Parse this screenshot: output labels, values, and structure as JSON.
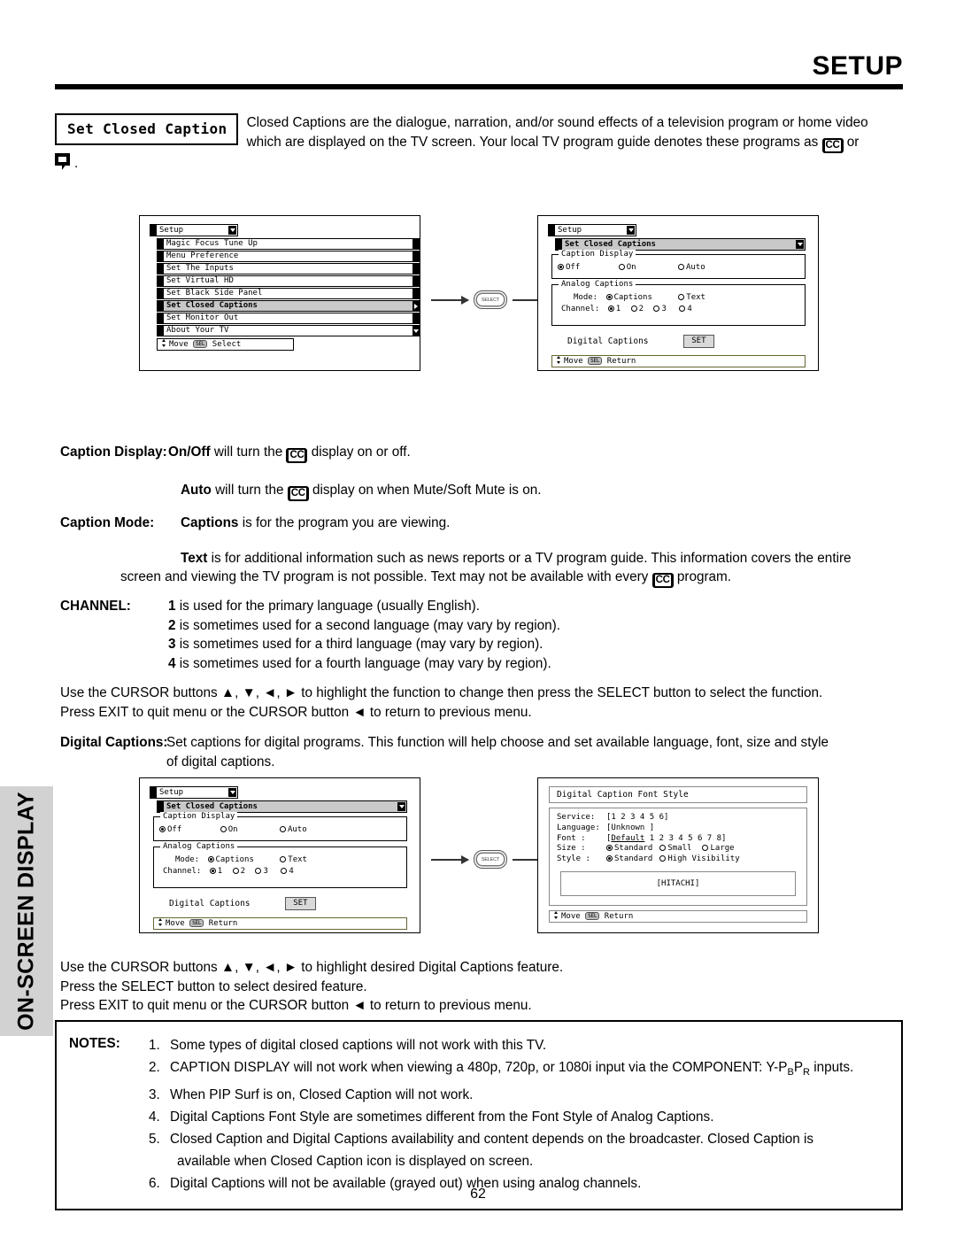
{
  "header": {
    "title": "SETUP"
  },
  "sidebar": {
    "label": "ON-SCREEN DISPLAY"
  },
  "intro": {
    "label": "Set Closed Caption",
    "line1": "Closed Captions are the dialogue, narration, and/or sound effects of a television program or home video",
    "line2_a": "which are displayed on the TV screen.  Your local TV program guide denotes these programs as",
    "line2_b": "or",
    "line3_period": "."
  },
  "icons": {
    "cc": "CC",
    "cc_icon_name": "closed-caption-icon",
    "balloon_icon_name": "speech-balloon-icon"
  },
  "connector": {
    "select_label": "SELECT"
  },
  "menu_setup": {
    "title": "Setup",
    "items": [
      "Magic Focus Tune Up",
      "Menu Preference",
      "Set The Inputs",
      "Set Virtual HD",
      "Set Black Side Panel",
      "Set Closed Captions",
      "Set Monitor Out",
      "About Your TV"
    ],
    "selected_index": 5,
    "footer_move": "Move",
    "footer_sel": "SEL",
    "footer_action": "Select"
  },
  "menu_closed_captions": {
    "title": "Setup",
    "subtitle": "Set Closed Captions",
    "caption_display": {
      "group_label": "Caption Display",
      "options": [
        "Off",
        "On",
        "Auto"
      ],
      "selected": "Off"
    },
    "analog_captions": {
      "group_label": "Analog Captions",
      "mode_label": "Mode:",
      "mode_options": [
        "Captions",
        "Text"
      ],
      "mode_selected": "Captions",
      "channel_label": "Channel:",
      "channel_options": [
        "1",
        "2",
        "3",
        "4"
      ],
      "channel_selected": "1"
    },
    "digital_captions_label": "Digital Captions",
    "set_button": "SET",
    "footer_move": "Move",
    "footer_sel": "SEL",
    "footer_action": "Return"
  },
  "menu_font_style": {
    "title": "Digital Caption Font Style",
    "rows": [
      {
        "key": "Service:",
        "value": "[1 2 3 4 5 6]"
      },
      {
        "key": "Language:",
        "value": "[Unknown    ]"
      },
      {
        "key": "Font    :",
        "value_pre": "[",
        "value_underline": "Default",
        "value_post": " 1 2 3 4 5 6 7 8]"
      }
    ],
    "size_row": {
      "key": "Size    :",
      "options": [
        "Standard",
        "Small",
        "Large"
      ],
      "selected": "Standard"
    },
    "style_row": {
      "key": "Style   :",
      "options": [
        "Standard",
        "High Visibility"
      ],
      "selected": "Standard"
    },
    "preview": "[HITACHI]",
    "footer_move": "Move",
    "footer_sel": "SEL",
    "footer_action": "Return"
  },
  "body": {
    "caption_display_label": "Caption Display:",
    "caption_display_l1_a": "On/Off",
    "caption_display_l1_b": "will turn the",
    "caption_display_l1_c": "display on or off.",
    "caption_display_l2_a": "Auto",
    "caption_display_l2_b": "will turn the",
    "caption_display_l2_c": "display on when Mute/Soft Mute is on.",
    "caption_mode_label": "Caption Mode:",
    "caption_mode_l1_a": "Captions",
    "caption_mode_l1_b": "is for the program you are viewing.",
    "caption_mode_l2_a": "Text",
    "caption_mode_l2_b": "is for additional information such as news reports or a TV program guide.  This information covers the entire",
    "caption_mode_l3_a": "screen and viewing the TV program is not possible.  Text may not be available with every",
    "caption_mode_l3_b": "program.",
    "channel_label": "CHANNEL:",
    "channel_items": [
      {
        "num": "1",
        "text": "is used for the primary language (usually English)."
      },
      {
        "num": "2",
        "text": "is sometimes used for a second language (may vary by region)."
      },
      {
        "num": "3",
        "text": "is sometimes used for a third language (may vary by region)."
      },
      {
        "num": "4",
        "text": "is sometimes used for a fourth language (may vary by region)."
      }
    ],
    "cursor_para_1_l1": "Use the CURSOR buttons ▲, ▼, ◄, ► to highlight the function to change then press the SELECT button to select the function.",
    "cursor_para_1_l2": "Press EXIT to quit menu or the CURSOR button ◄ to return to previous menu.",
    "digital_captions_label": "Digital Captions:",
    "digital_captions_l1": "Set captions for digital programs.  This function will help choose and set  available language, font, size and style",
    "digital_captions_l2": "of digital captions.",
    "cursor_para_2_l1": "Use the CURSOR buttons ▲, ▼, ◄, ► to highlight desired Digital Captions feature.",
    "cursor_para_2_l2": "Press the SELECT button to select desired feature.",
    "cursor_para_2_l3": "Press EXIT to quit menu or the CURSOR button ◄ to return to previous menu."
  },
  "notes": {
    "label": "NOTES:",
    "items": [
      {
        "num": "1.",
        "text": "Some types of digital closed captions will not work with this TV."
      },
      {
        "num": "2.",
        "text_a": "CAPTION DISPLAY will not work when viewing a 480p, 720p, or 1080i input via the COMPONENT: Y-P",
        "sub_b": "B",
        "text_c": "P",
        "sub_d": "R",
        "text_e": " inputs."
      },
      {
        "num": "3.",
        "text": "When PIP Surf is on, Closed Caption will not work."
      },
      {
        "num": "4.",
        "text": "Digital Captions Font Style are sometimes different from the Font Style of Analog Captions."
      },
      {
        "num": "5.",
        "text": "Closed Caption and Digital Captions availability and content depends on the broadcaster.  Closed Caption is",
        "text2": "available when Closed Caption icon is displayed on screen."
      },
      {
        "num": "6.",
        "text": "Digital Captions will not be available (grayed out) when using analog channels."
      }
    ]
  },
  "footer": {
    "page_number": "62"
  }
}
